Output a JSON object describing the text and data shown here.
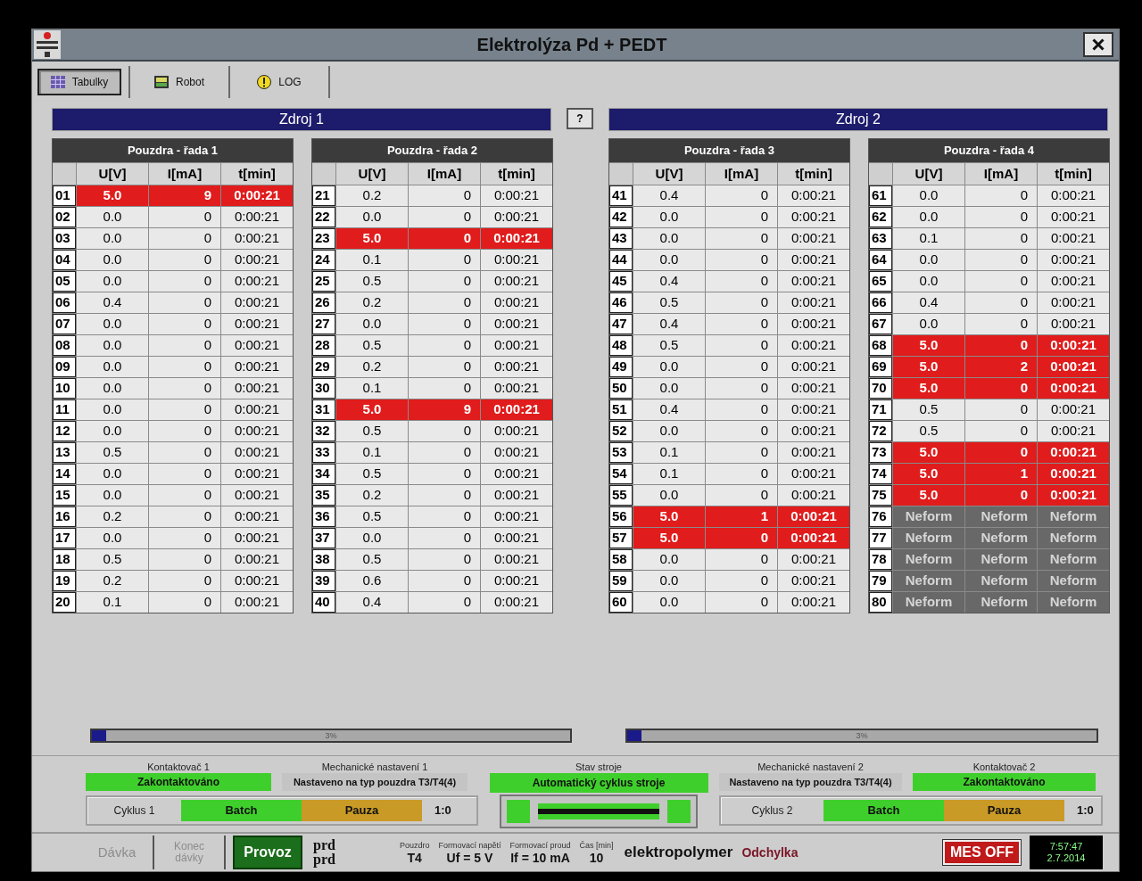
{
  "window": {
    "title": "Elektrolýza Pd + PEDT"
  },
  "tabs": [
    {
      "label": "Tabulky",
      "selected": true
    },
    {
      "label": "Robot",
      "selected": false
    },
    {
      "label": "LOG",
      "selected": false
    }
  ],
  "help_button": {
    "label": "?"
  },
  "sources": [
    {
      "title": "Zdroj 1",
      "tables": [
        {
          "title": "Pouzdra - řada 1",
          "columns": [
            "U[V]",
            "I[mA]",
            "t[min]"
          ],
          "rows": [
            {
              "index": "01",
              "kind": "measured",
              "highlighted": true,
              "values": [
                "5.0",
                "9",
                "0:00:21"
              ]
            },
            {
              "index": "02",
              "kind": "measured",
              "highlighted": false,
              "values": [
                "0.0",
                "0",
                "0:00:21"
              ]
            },
            {
              "index": "03",
              "kind": "measured",
              "highlighted": false,
              "values": [
                "0.0",
                "0",
                "0:00:21"
              ]
            },
            {
              "index": "04",
              "kind": "measured",
              "highlighted": false,
              "values": [
                "0.0",
                "0",
                "0:00:21"
              ]
            },
            {
              "index": "05",
              "kind": "measured",
              "highlighted": false,
              "values": [
                "0.0",
                "0",
                "0:00:21"
              ]
            },
            {
              "index": "06",
              "kind": "measured",
              "highlighted": false,
              "values": [
                "0.4",
                "0",
                "0:00:21"
              ]
            },
            {
              "index": "07",
              "kind": "measured",
              "highlighted": false,
              "values": [
                "0.0",
                "0",
                "0:00:21"
              ]
            },
            {
              "index": "08",
              "kind": "measured",
              "highlighted": false,
              "values": [
                "0.0",
                "0",
                "0:00:21"
              ]
            },
            {
              "index": "09",
              "kind": "measured",
              "highlighted": false,
              "values": [
                "0.0",
                "0",
                "0:00:21"
              ]
            },
            {
              "index": "10",
              "kind": "measured",
              "highlighted": false,
              "values": [
                "0.0",
                "0",
                "0:00:21"
              ]
            },
            {
              "index": "11",
              "kind": "measured",
              "highlighted": false,
              "values": [
                "0.0",
                "0",
                "0:00:21"
              ]
            },
            {
              "index": "12",
              "kind": "measured",
              "highlighted": false,
              "values": [
                "0.0",
                "0",
                "0:00:21"
              ]
            },
            {
              "index": "13",
              "kind": "measured",
              "highlighted": false,
              "values": [
                "0.5",
                "0",
                "0:00:21"
              ]
            },
            {
              "index": "14",
              "kind": "measured",
              "highlighted": false,
              "values": [
                "0.0",
                "0",
                "0:00:21"
              ]
            },
            {
              "index": "15",
              "kind": "measured",
              "highlighted": false,
              "values": [
                "0.0",
                "0",
                "0:00:21"
              ]
            },
            {
              "index": "16",
              "kind": "measured",
              "highlighted": false,
              "values": [
                "0.2",
                "0",
                "0:00:21"
              ]
            },
            {
              "index": "17",
              "kind": "measured",
              "highlighted": false,
              "values": [
                "0.0",
                "0",
                "0:00:21"
              ]
            },
            {
              "index": "18",
              "kind": "measured",
              "highlighted": false,
              "values": [
                "0.5",
                "0",
                "0:00:21"
              ]
            },
            {
              "index": "19",
              "kind": "measured",
              "highlighted": false,
              "values": [
                "0.2",
                "0",
                "0:00:21"
              ]
            },
            {
              "index": "20",
              "kind": "measured",
              "highlighted": false,
              "values": [
                "0.1",
                "0",
                "0:00:21"
              ]
            }
          ]
        },
        {
          "title": "Pouzdra - řada 2",
          "columns": [
            "U[V]",
            "I[mA]",
            "t[min]"
          ],
          "rows": [
            {
              "index": "21",
              "kind": "measured",
              "highlighted": false,
              "values": [
                "0.2",
                "0",
                "0:00:21"
              ]
            },
            {
              "index": "22",
              "kind": "measured",
              "highlighted": false,
              "values": [
                "0.0",
                "0",
                "0:00:21"
              ]
            },
            {
              "index": "23",
              "kind": "measured",
              "highlighted": true,
              "values": [
                "5.0",
                "0",
                "0:00:21"
              ]
            },
            {
              "index": "24",
              "kind": "measured",
              "highlighted": false,
              "values": [
                "0.1",
                "0",
                "0:00:21"
              ]
            },
            {
              "index": "25",
              "kind": "measured",
              "highlighted": false,
              "values": [
                "0.5",
                "0",
                "0:00:21"
              ]
            },
            {
              "index": "26",
              "kind": "measured",
              "highlighted": false,
              "values": [
                "0.2",
                "0",
                "0:00:21"
              ]
            },
            {
              "index": "27",
              "kind": "measured",
              "highlighted": false,
              "values": [
                "0.0",
                "0",
                "0:00:21"
              ]
            },
            {
              "index": "28",
              "kind": "measured",
              "highlighted": false,
              "values": [
                "0.5",
                "0",
                "0:00:21"
              ]
            },
            {
              "index": "29",
              "kind": "measured",
              "highlighted": false,
              "values": [
                "0.2",
                "0",
                "0:00:21"
              ]
            },
            {
              "index": "30",
              "kind": "measured",
              "highlighted": false,
              "values": [
                "0.1",
                "0",
                "0:00:21"
              ]
            },
            {
              "index": "31",
              "kind": "measured",
              "highlighted": true,
              "values": [
                "5.0",
                "9",
                "0:00:21"
              ]
            },
            {
              "index": "32",
              "kind": "measured",
              "highlighted": false,
              "values": [
                "0.5",
                "0",
                "0:00:21"
              ]
            },
            {
              "index": "33",
              "kind": "measured",
              "highlighted": false,
              "values": [
                "0.1",
                "0",
                "0:00:21"
              ]
            },
            {
              "index": "34",
              "kind": "measured",
              "highlighted": false,
              "values": [
                "0.5",
                "0",
                "0:00:21"
              ]
            },
            {
              "index": "35",
              "kind": "measured",
              "highlighted": false,
              "values": [
                "0.2",
                "0",
                "0:00:21"
              ]
            },
            {
              "index": "36",
              "kind": "measured",
              "highlighted": false,
              "values": [
                "0.5",
                "0",
                "0:00:21"
              ]
            },
            {
              "index": "37",
              "kind": "measured",
              "highlighted": false,
              "values": [
                "0.0",
                "0",
                "0:00:21"
              ]
            },
            {
              "index": "38",
              "kind": "measured",
              "highlighted": false,
              "values": [
                "0.5",
                "0",
                "0:00:21"
              ]
            },
            {
              "index": "39",
              "kind": "measured",
              "highlighted": false,
              "values": [
                "0.6",
                "0",
                "0:00:21"
              ]
            },
            {
              "index": "40",
              "kind": "measured",
              "highlighted": false,
              "values": [
                "0.4",
                "0",
                "0:00:21"
              ]
            }
          ]
        }
      ],
      "progress": {
        "level": 0.03,
        "label": "3%"
      }
    },
    {
      "title": "Zdroj 2",
      "tables": [
        {
          "title": "Pouzdra - řada 3",
          "columns": [
            "U[V]",
            "I[mA]",
            "t[min]"
          ],
          "rows": [
            {
              "index": "41",
              "kind": "measured",
              "highlighted": false,
              "values": [
                "0.4",
                "0",
                "0:00:21"
              ]
            },
            {
              "index": "42",
              "kind": "measured",
              "highlighted": false,
              "values": [
                "0.0",
                "0",
                "0:00:21"
              ]
            },
            {
              "index": "43",
              "kind": "measured",
              "highlighted": false,
              "values": [
                "0.0",
                "0",
                "0:00:21"
              ]
            },
            {
              "index": "44",
              "kind": "measured",
              "highlighted": false,
              "values": [
                "0.0",
                "0",
                "0:00:21"
              ]
            },
            {
              "index": "45",
              "kind": "measured",
              "highlighted": false,
              "values": [
                "0.4",
                "0",
                "0:00:21"
              ]
            },
            {
              "index": "46",
              "kind": "measured",
              "highlighted": false,
              "values": [
                "0.5",
                "0",
                "0:00:21"
              ]
            },
            {
              "index": "47",
              "kind": "measured",
              "highlighted": false,
              "values": [
                "0.4",
                "0",
                "0:00:21"
              ]
            },
            {
              "index": "48",
              "kind": "measured",
              "highlighted": false,
              "values": [
                "0.5",
                "0",
                "0:00:21"
              ]
            },
            {
              "index": "49",
              "kind": "measured",
              "highlighted": false,
              "values": [
                "0.0",
                "0",
                "0:00:21"
              ]
            },
            {
              "index": "50",
              "kind": "measured",
              "highlighted": false,
              "values": [
                "0.0",
                "0",
                "0:00:21"
              ]
            },
            {
              "index": "51",
              "kind": "measured",
              "highlighted": false,
              "values": [
                "0.4",
                "0",
                "0:00:21"
              ]
            },
            {
              "index": "52",
              "kind": "measured",
              "highlighted": false,
              "values": [
                "0.0",
                "0",
                "0:00:21"
              ]
            },
            {
              "index": "53",
              "kind": "measured",
              "highlighted": false,
              "values": [
                "0.1",
                "0",
                "0:00:21"
              ]
            },
            {
              "index": "54",
              "kind": "measured",
              "highlighted": false,
              "values": [
                "0.1",
                "0",
                "0:00:21"
              ]
            },
            {
              "index": "55",
              "kind": "measured",
              "highlighted": false,
              "values": [
                "0.0",
                "0",
                "0:00:21"
              ]
            },
            {
              "index": "56",
              "kind": "measured",
              "highlighted": true,
              "values": [
                "5.0",
                "1",
                "0:00:21"
              ]
            },
            {
              "index": "57",
              "kind": "measured",
              "highlighted": true,
              "values": [
                "5.0",
                "0",
                "0:00:21"
              ]
            },
            {
              "index": "58",
              "kind": "measured",
              "highlighted": false,
              "values": [
                "0.0",
                "0",
                "0:00:21"
              ]
            },
            {
              "index": "59",
              "kind": "measured",
              "highlighted": false,
              "values": [
                "0.0",
                "0",
                "0:00:21"
              ]
            },
            {
              "index": "60",
              "kind": "measured",
              "highlighted": false,
              "values": [
                "0.0",
                "0",
                "0:00:21"
              ]
            }
          ]
        },
        {
          "title": "Pouzdra - řada 4",
          "columns": [
            "U[V]",
            "I[mA]",
            "t[min]"
          ],
          "rows": [
            {
              "index": "61",
              "kind": "measured",
              "highlighted": false,
              "values": [
                "0.0",
                "0",
                "0:00:21"
              ]
            },
            {
              "index": "62",
              "kind": "measured",
              "highlighted": false,
              "values": [
                "0.0",
                "0",
                "0:00:21"
              ]
            },
            {
              "index": "63",
              "kind": "measured",
              "highlighted": false,
              "values": [
                "0.1",
                "0",
                "0:00:21"
              ]
            },
            {
              "index": "64",
              "kind": "measured",
              "highlighted": false,
              "values": [
                "0.0",
                "0",
                "0:00:21"
              ]
            },
            {
              "index": "65",
              "kind": "measured",
              "highlighted": false,
              "values": [
                "0.0",
                "0",
                "0:00:21"
              ]
            },
            {
              "index": "66",
              "kind": "measured",
              "highlighted": false,
              "values": [
                "0.4",
                "0",
                "0:00:21"
              ]
            },
            {
              "index": "67",
              "kind": "measured",
              "highlighted": false,
              "values": [
                "0.0",
                "0",
                "0:00:21"
              ]
            },
            {
              "index": "68",
              "kind": "measured",
              "highlighted": true,
              "values": [
                "5.0",
                "0",
                "0:00:21"
              ]
            },
            {
              "index": "69",
              "kind": "measured",
              "highlighted": true,
              "values": [
                "5.0",
                "2",
                "0:00:21"
              ]
            },
            {
              "index": "70",
              "kind": "measured",
              "highlighted": true,
              "values": [
                "5.0",
                "0",
                "0:00:21"
              ]
            },
            {
              "index": "71",
              "kind": "measured",
              "highlighted": false,
              "values": [
                "0.5",
                "0",
                "0:00:21"
              ]
            },
            {
              "index": "72",
              "kind": "measured",
              "highlighted": false,
              "values": [
                "0.5",
                "0",
                "0:00:21"
              ]
            },
            {
              "index": "73",
              "kind": "measured",
              "highlighted": true,
              "values": [
                "5.0",
                "0",
                "0:00:21"
              ]
            },
            {
              "index": "74",
              "kind": "measured",
              "highlighted": true,
              "values": [
                "5.0",
                "1",
                "0:00:21"
              ]
            },
            {
              "index": "75",
              "kind": "measured",
              "highlighted": true,
              "values": [
                "5.0",
                "0",
                "0:00:21"
              ]
            },
            {
              "index": "76",
              "kind": "unformed",
              "highlighted": false,
              "values": [
                "Neform",
                "Neform",
                "Neform"
              ]
            },
            {
              "index": "77",
              "kind": "unformed",
              "highlighted": false,
              "values": [
                "Neform",
                "Neform",
                "Neform"
              ]
            },
            {
              "index": "78",
              "kind": "unformed",
              "highlighted": false,
              "values": [
                "Neform",
                "Neform",
                "Neform"
              ]
            },
            {
              "index": "79",
              "kind": "unformed",
              "highlighted": false,
              "values": [
                "Neform",
                "Neform",
                "Neform"
              ]
            },
            {
              "index": "80",
              "kind": "unformed",
              "highlighted": false,
              "values": [
                "Neform",
                "Neform",
                "Neform"
              ]
            }
          ]
        }
      ],
      "progress": {
        "level": 0.03,
        "label": "3%"
      }
    }
  ],
  "left_group": {
    "panels": [
      {
        "kind": "contactor",
        "label": "Kontaktovač 1",
        "value": "Zakontaktováno"
      },
      {
        "kind": "setting",
        "label": "Mechanické nastavení 1",
        "value": "Nastaveno na typ pouzdra T3/T4(4)"
      }
    ],
    "cycle": {
      "label": "Cyklus 1",
      "mode": "Batch",
      "state": "Pauza",
      "ratio": "1:0"
    }
  },
  "machine_state": {
    "label": "Stav stroje",
    "value": "Automatický cyklus stroje"
  },
  "right_group": {
    "panels": [
      {
        "kind": "setting",
        "label": "Mechanické nastavení 2",
        "value": "Nastaveno na typ pouzdra T3/T4(4)"
      },
      {
        "kind": "contactor",
        "label": "Kontaktovač 2",
        "value": "Zakontaktováno"
      }
    ],
    "cycle": {
      "label": "Cyklus 2",
      "mode": "Batch",
      "state": "Pauza",
      "ratio": "1:0"
    }
  },
  "bottom_bar": {
    "buttons": [
      {
        "label": "Dávka",
        "disabled": true,
        "active": false
      },
      {
        "label": "Konec dávky",
        "disabled": true,
        "active": false
      },
      {
        "label": "Provoz",
        "disabled": false,
        "active": true
      }
    ],
    "notes": [
      "prd",
      "prd"
    ],
    "parameters": [
      {
        "label": "Pouzdro",
        "value": "T4"
      },
      {
        "label": "Formovací napětí",
        "value": "Uf = 5 V"
      },
      {
        "label": "Formovací proud",
        "value": "If = 10 mA"
      },
      {
        "label": "Čas [min]",
        "value": "10"
      }
    ],
    "recipe": "elektropolymer",
    "deviation": "Odchylka",
    "mes_button": "MES OFF",
    "clock": {
      "time": "7:57:47",
      "date": "2.7.2014"
    }
  }
}
